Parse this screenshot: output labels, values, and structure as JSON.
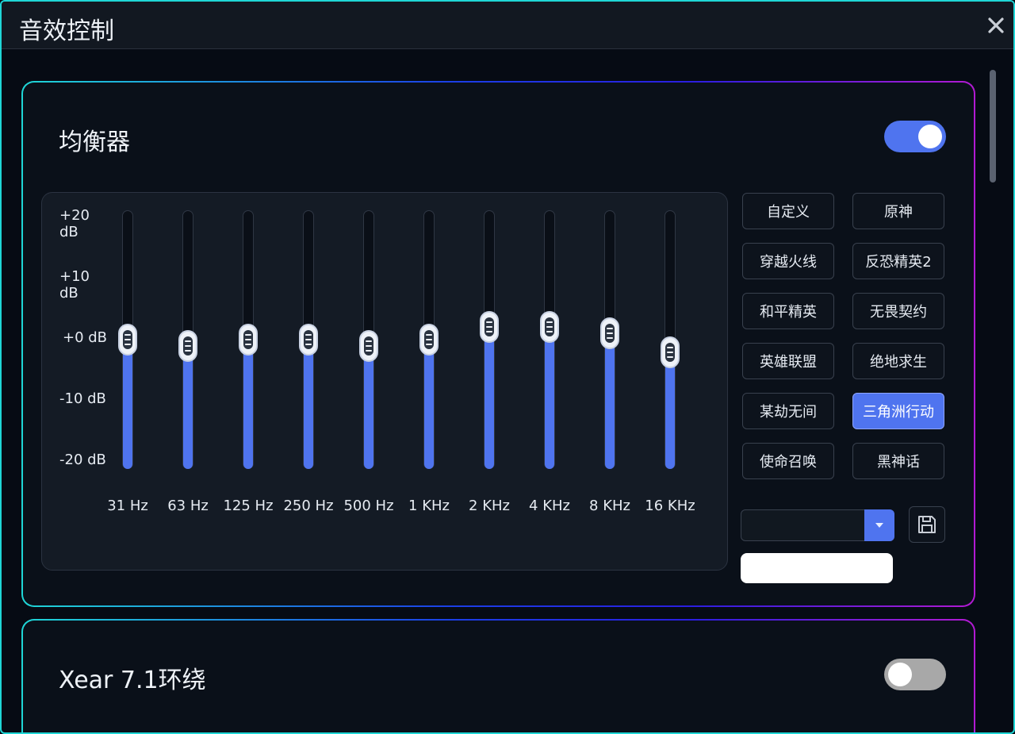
{
  "window": {
    "title": "音效控制"
  },
  "equalizer": {
    "title": "均衡器",
    "enabled": true,
    "db_labels": [
      "+20 dB",
      "+10 dB",
      "+0 dB",
      "-10 dB",
      "-20 dB"
    ],
    "bands": [
      {
        "freq": "31 Hz",
        "gain_db": 0
      },
      {
        "freq": "63 Hz",
        "gain_db": -1
      },
      {
        "freq": "125 Hz",
        "gain_db": 0
      },
      {
        "freq": "250 Hz",
        "gain_db": 0
      },
      {
        "freq": "500 Hz",
        "gain_db": -1
      },
      {
        "freq": "1 KHz",
        "gain_db": 0
      },
      {
        "freq": "2 KHz",
        "gain_db": 2
      },
      {
        "freq": "4 KHz",
        "gain_db": 2
      },
      {
        "freq": "8 KHz",
        "gain_db": 1
      },
      {
        "freq": "16 KHz",
        "gain_db": -2
      }
    ],
    "presets": [
      "自定义",
      "原神",
      "穿越火线",
      "反恐精英2",
      "和平精英",
      "无畏契约",
      "英雄联盟",
      "绝地求生",
      "某劫无间",
      "三角洲行动",
      "使命召唤",
      "黑神话"
    ],
    "active_preset": "三角洲行动",
    "preset_select_value": "",
    "preset_name_value": "",
    "colors": {
      "accent": "#4f74ef",
      "frame": "#1fd6d6"
    }
  },
  "surround": {
    "title": "Xear 7.1环绕",
    "enabled": false
  }
}
